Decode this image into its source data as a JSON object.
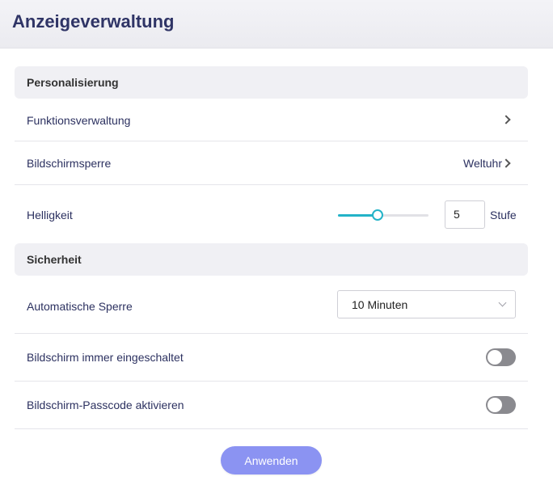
{
  "header": {
    "title": "Anzeigeverwaltung"
  },
  "personalisierung": {
    "section_title": "Personalisierung",
    "funktionsverwaltung": {
      "label": "Funktionsverwaltung"
    },
    "bildschirmsperre": {
      "label": "Bildschirmsperre",
      "value": "Weltuhr"
    },
    "helligkeit": {
      "label": "Helligkeit",
      "value": "5",
      "unit": "Stufe",
      "slider_fraction": 0.44
    }
  },
  "sicherheit": {
    "section_title": "Sicherheit",
    "automatische_sperre": {
      "label": "Automatische Sperre",
      "selected": "10 Minuten"
    },
    "immer_eingeschaltet": {
      "label": "Bildschirm immer eingeschaltet",
      "enabled": false
    },
    "passcode": {
      "label": "Bildschirm-Passcode aktivieren",
      "enabled": false
    }
  },
  "actions": {
    "apply_label": "Anwenden"
  },
  "colors": {
    "accent": "#23b3c8",
    "button": "#8b93f2",
    "title": "#2f3466",
    "toggle_off": "#8a8a8f"
  }
}
